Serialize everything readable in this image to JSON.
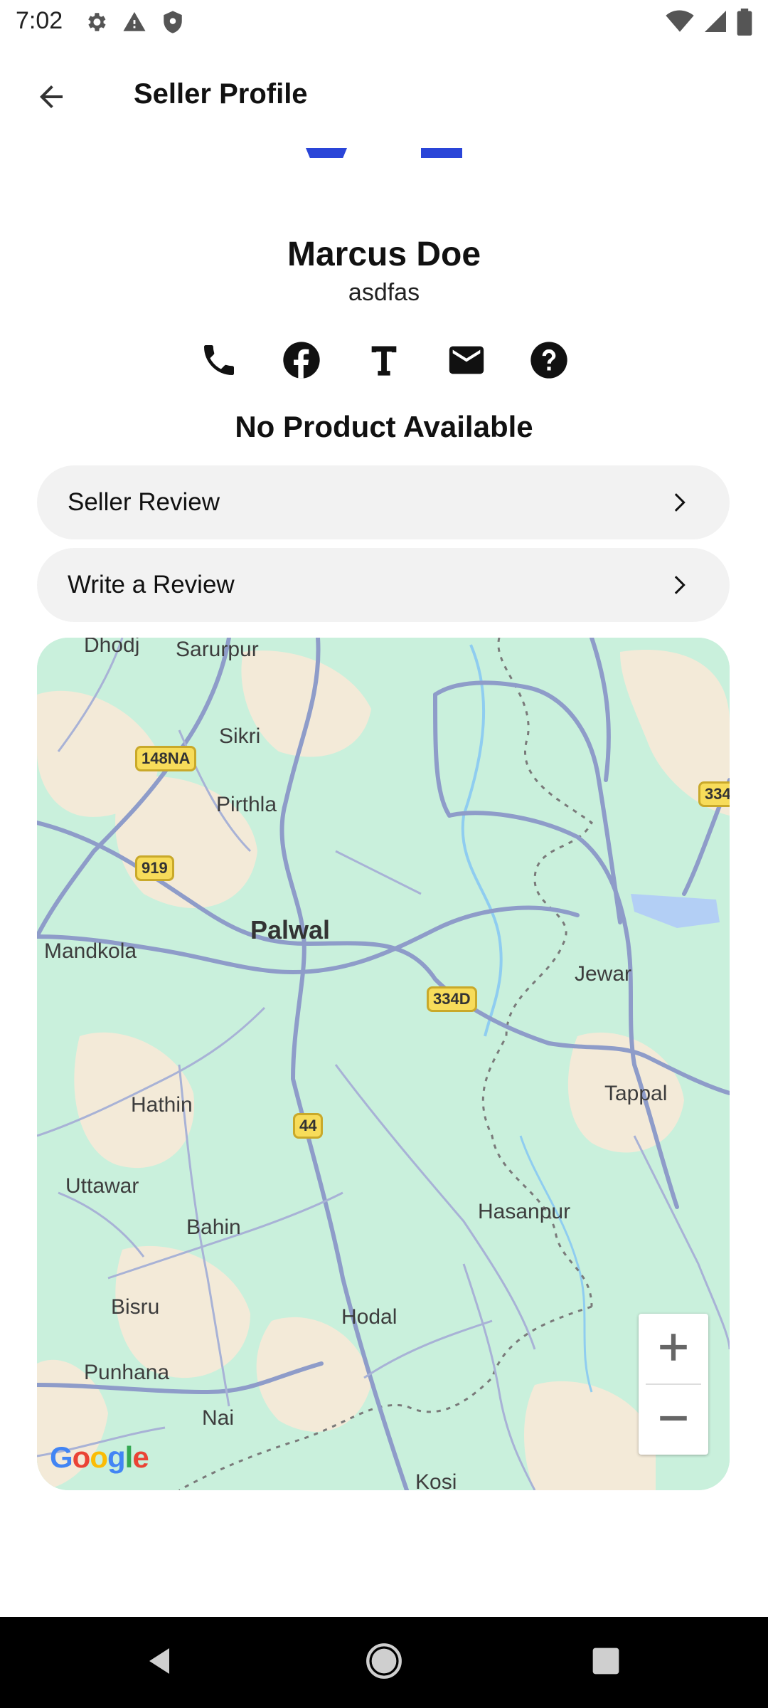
{
  "status_bar": {
    "time": "7:02",
    "icons": [
      "gear-icon",
      "warning-icon",
      "shield-icon",
      "wifi-icon",
      "signal-icon",
      "battery-icon"
    ]
  },
  "app_bar": {
    "title": "Seller Profile",
    "back_icon": "arrow-back-icon"
  },
  "profile": {
    "name": "Marcus Doe",
    "subtitle": "asdfas",
    "accent_color": "#2a45d8"
  },
  "contact_icons": [
    "phone-icon",
    "facebook-icon",
    "text-icon",
    "email-icon",
    "help-icon"
  ],
  "no_product_text": "No Product Available",
  "actions": [
    {
      "label": "Seller Review",
      "icon": "chevron-right-icon"
    },
    {
      "label": "Write a Review",
      "icon": "chevron-right-icon"
    }
  ],
  "map": {
    "towns": [
      "Dhodj",
      "Sarurpur",
      "Sikri",
      "Pirthla",
      "Palwal",
      "Mandkola",
      "Jewar",
      "Hathin",
      "Tappal",
      "Uttawar",
      "Bahin",
      "Hasanpur",
      "Bisru",
      "Hodal",
      "Punhana",
      "Nai",
      "Kosi"
    ],
    "road_shields": [
      "148NA",
      "919",
      "334D",
      "44",
      "334"
    ],
    "zoom_in": "+",
    "zoom_out": "−",
    "attribution": "Google",
    "colors": {
      "land": "#c9f0dc",
      "urban": "#f3ead8",
      "road": "#8e9cc9",
      "water": "#a8d8f5",
      "shield": "#f7dc5a"
    }
  },
  "nav_bar": {
    "icons": [
      "nav-back-icon",
      "nav-home-icon",
      "nav-recents-icon"
    ]
  }
}
